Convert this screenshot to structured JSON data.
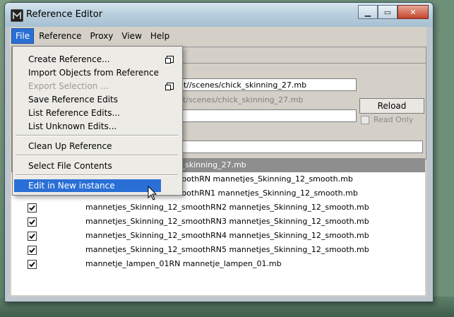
{
  "window": {
    "title": "Reference Editor"
  },
  "window_controls": {
    "minimize": "▁",
    "maximize": "▭",
    "close": "✕"
  },
  "menubar": [
    "File",
    "Reference",
    "Proxy",
    "View",
    "Help"
  ],
  "file_menu": {
    "items": [
      {
        "label": "Create Reference...",
        "has_options": true
      },
      {
        "label": "Import Objects from Reference",
        "has_options": false
      },
      {
        "label": "Export Selection ...",
        "has_options": true,
        "disabled": true
      },
      {
        "label": "Save Reference Edits",
        "has_options": false
      },
      {
        "label": "List Reference Edits...",
        "has_options": false
      },
      {
        "label": "List Unknown Edits...",
        "has_options": false
      },
      {
        "label": "Clean Up Reference",
        "has_options": false
      },
      {
        "label": "Select File Contents",
        "has_options": false
      },
      {
        "label": "Edit in New instance",
        "has_options": false,
        "highlighted": true
      }
    ]
  },
  "fields": {
    "path1": "ect//scenes/chick_skinning_27.mb",
    "path2": "ect/scenes/chick_skinning_27.mb",
    "path3": "",
    "filter": ""
  },
  "buttons": {
    "reload": "Reload"
  },
  "readonly": {
    "label": "Read Only",
    "checked": false
  },
  "references": [
    {
      "name": "ick_skinning_27.mb",
      "selected": true,
      "checked": false
    },
    {
      "name": "smoothRN mannetjes_Skinning_12_smooth.mb",
      "checked": true
    },
    {
      "name": "smoothRN1 mannetjes_Skinning_12_smooth.mb",
      "checked": true
    },
    {
      "name": "mannetjes_Skinning_12_smoothRN2 mannetjes_Skinning_12_smooth.mb",
      "checked": true
    },
    {
      "name": "mannetjes_Skinning_12_smoothRN3 mannetjes_Skinning_12_smooth.mb",
      "checked": true
    },
    {
      "name": "mannetjes_Skinning_12_smoothRN4 mannetjes_Skinning_12_smooth.mb",
      "checked": true
    },
    {
      "name": "mannetjes_Skinning_12_smoothRN5 mannetjes_Skinning_12_smooth.mb",
      "checked": true
    },
    {
      "name": "mannetje_lampen_01RN mannetje_lampen_01.mb",
      "checked": true
    }
  ],
  "colors": {
    "menu_highlight": "#2a6fd6",
    "selected_row": "#8e8e8e",
    "panel": "#d4d0c8"
  }
}
